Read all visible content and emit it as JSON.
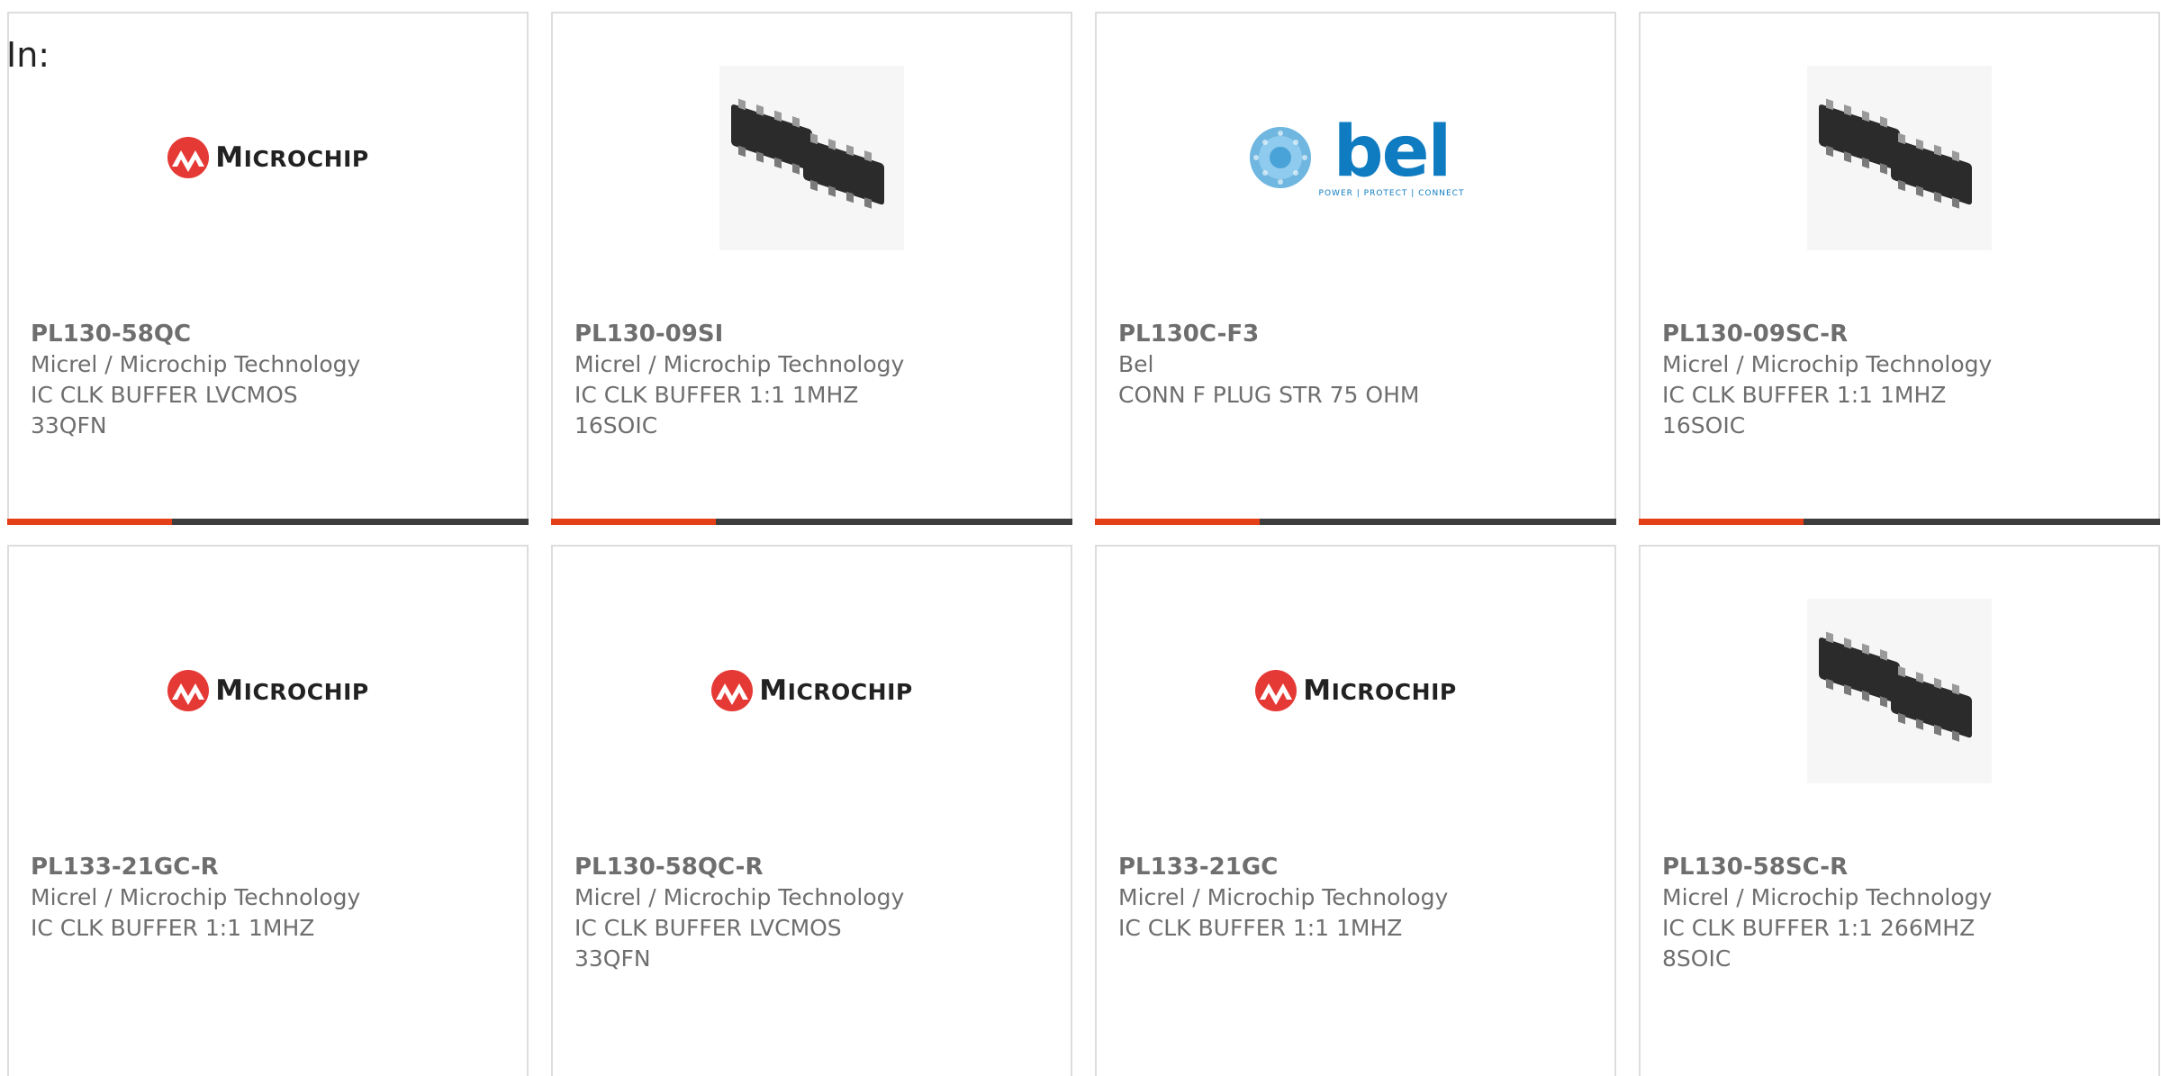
{
  "page": {
    "in_label": "In:"
  },
  "brand_colors": {
    "accent": "#e53f17",
    "bar_dark": "#3d3d3d",
    "microchip_red": "#e53935",
    "bel_blue": "#0f7cc1"
  },
  "bel_logo": {
    "word": "bel",
    "tagline": "POWER | PROTECT | CONNECT"
  },
  "microchip_logo": {
    "word": "MICROCHIP"
  },
  "products": [
    {
      "part_number": "PL130-58QC",
      "manufacturer": "Micrel / Microchip Technology",
      "description": "IC CLK BUFFER LVCMOS 33QFN",
      "image": "microchip-logo"
    },
    {
      "part_number": "PL130-09SI",
      "manufacturer": "Micrel / Microchip Technology",
      "description": "IC CLK BUFFER 1:1 1MHZ 16SOIC",
      "image": "soic-chip-photo"
    },
    {
      "part_number": "PL130C-F3",
      "manufacturer": "Bel",
      "description": "CONN F PLUG STR 75 OHM",
      "image": "bel-logo"
    },
    {
      "part_number": "PL130-09SC-R",
      "manufacturer": "Micrel / Microchip Technology",
      "description": "IC CLK BUFFER 1:1 1MHZ 16SOIC",
      "image": "soic-chip-photo"
    },
    {
      "part_number": "PL133-21GC-R",
      "manufacturer": "Micrel / Microchip Technology",
      "description": "IC CLK BUFFER 1:1 1MHZ",
      "image": "microchip-logo"
    },
    {
      "part_number": "PL130-58QC-R",
      "manufacturer": "Micrel / Microchip Technology",
      "description": "IC CLK BUFFER LVCMOS 33QFN",
      "image": "microchip-logo"
    },
    {
      "part_number": "PL133-21GC",
      "manufacturer": "Micrel / Microchip Technology",
      "description": "IC CLK BUFFER 1:1 1MHZ",
      "image": "microchip-logo"
    },
    {
      "part_number": "PL130-58SC-R",
      "manufacturer": "Micrel / Microchip Technology",
      "description": "IC CLK BUFFER 1:1 266MHZ 8SOIC",
      "image": "soic-chip-photo"
    }
  ]
}
